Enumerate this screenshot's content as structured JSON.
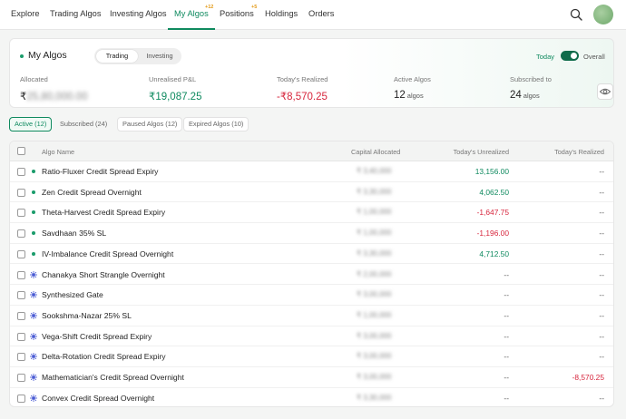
{
  "nav": {
    "items": [
      {
        "label": "Explore"
      },
      {
        "label": "Trading Algos"
      },
      {
        "label": "Investing Algos"
      },
      {
        "label": "My Algos",
        "badge": "+12"
      },
      {
        "label": "Positions",
        "badge": "+5"
      },
      {
        "label": "Holdings"
      },
      {
        "label": "Orders"
      }
    ],
    "active": "My Algos",
    "icons": {
      "search": "search-icon",
      "avatar": "avatar"
    }
  },
  "summary": {
    "title": "My Algos",
    "segments": {
      "trading": "Trading",
      "investing": "Investing",
      "selected": "Trading"
    },
    "today_label": "Today",
    "overall_label": "Overall",
    "toggle_on": true,
    "stats": {
      "allocated": {
        "label": "Allocated",
        "currency": "₹",
        "value": "25,80,000.00"
      },
      "unrealised": {
        "label": "Unrealised P&L",
        "value": "₹19,087.25"
      },
      "realized": {
        "label": "Today's Realized",
        "value": "-₹8,570.25"
      },
      "active": {
        "label": "Active Algos",
        "value": "12",
        "unit": "algos"
      },
      "subscribed": {
        "label": "Subscribed to",
        "value": "24",
        "unit": "algos"
      }
    },
    "eye_icon": "eye-icon"
  },
  "filters": [
    {
      "label": "Active (12)"
    },
    {
      "label": "Subscribed (24)"
    },
    {
      "label": "Paused Algos (12)"
    },
    {
      "label": "Expired Algos (10)"
    }
  ],
  "table": {
    "headers": {
      "name": "Algo Name",
      "capital": "Capital Allocated",
      "unrealized": "Today's Unrealized",
      "realized": "Today's Realized"
    },
    "rows": [
      {
        "name": "Ratio-Fluxer Credit Spread Expiry",
        "icon": "dot",
        "capital": "₹ 3,40,000",
        "unrealized": "13,156.00",
        "unr_color": "green",
        "realized": "--",
        "rea_color": "muted"
      },
      {
        "name": "Zen Credit Spread Overnight",
        "icon": "dot",
        "capital": "₹ 3,30,000",
        "unrealized": "4,062.50",
        "unr_color": "green",
        "realized": "--",
        "rea_color": "muted"
      },
      {
        "name": "Theta-Harvest Credit Spread Expiry",
        "icon": "dot",
        "capital": "₹ 1,00,000",
        "unrealized": "-1,647.75",
        "unr_color": "red",
        "realized": "--",
        "rea_color": "muted"
      },
      {
        "name": "Savdhaan 35% SL",
        "icon": "dot",
        "capital": "₹ 1,00,000",
        "unrealized": "-1,196.00",
        "unr_color": "red",
        "realized": "--",
        "rea_color": "muted"
      },
      {
        "name": "IV-Imbalance Credit Spread Overnight",
        "icon": "dot",
        "capital": "₹ 3,30,000",
        "unrealized": "4,712.50",
        "unr_color": "green",
        "realized": "--",
        "rea_color": "muted"
      },
      {
        "name": "Chanakya Short Strangle Overnight",
        "icon": "star",
        "capital": "₹ 2,00,000",
        "unrealized": "--",
        "unr_color": "muted",
        "realized": "--",
        "rea_color": "muted"
      },
      {
        "name": "Synthesized Gate",
        "icon": "star",
        "capital": "₹ 3,00,000",
        "unrealized": "--",
        "unr_color": "muted",
        "realized": "--",
        "rea_color": "muted"
      },
      {
        "name": "Sookshma-Nazar 25% SL",
        "icon": "star",
        "capital": "₹ 1,00,000",
        "unrealized": "--",
        "unr_color": "muted",
        "realized": "--",
        "rea_color": "muted"
      },
      {
        "name": "Vega-Shift Credit Spread Expiry",
        "icon": "star",
        "capital": "₹ 3,00,000",
        "unrealized": "--",
        "unr_color": "muted",
        "realized": "--",
        "rea_color": "muted"
      },
      {
        "name": "Delta-Rotation Credit Spread Expiry",
        "icon": "star",
        "capital": "₹ 3,00,000",
        "unrealized": "--",
        "unr_color": "muted",
        "realized": "--",
        "rea_color": "muted"
      },
      {
        "name": "Mathematician's Credit Spread Overnight",
        "icon": "star",
        "capital": "₹ 3,00,000",
        "unrealized": "--",
        "unr_color": "muted",
        "realized": "-8,570.25",
        "rea_color": "red"
      },
      {
        "name": "Convex Credit Spread Overnight",
        "icon": "star",
        "capital": "₹ 3,30,000",
        "unrealized": "--",
        "unr_color": "muted",
        "realized": "--",
        "rea_color": "muted"
      }
    ]
  },
  "colors": {
    "accent": "#0f8a5f",
    "negative": "#d7263d",
    "badge": "#e39a17",
    "star_icon": "#4a5bd4"
  }
}
